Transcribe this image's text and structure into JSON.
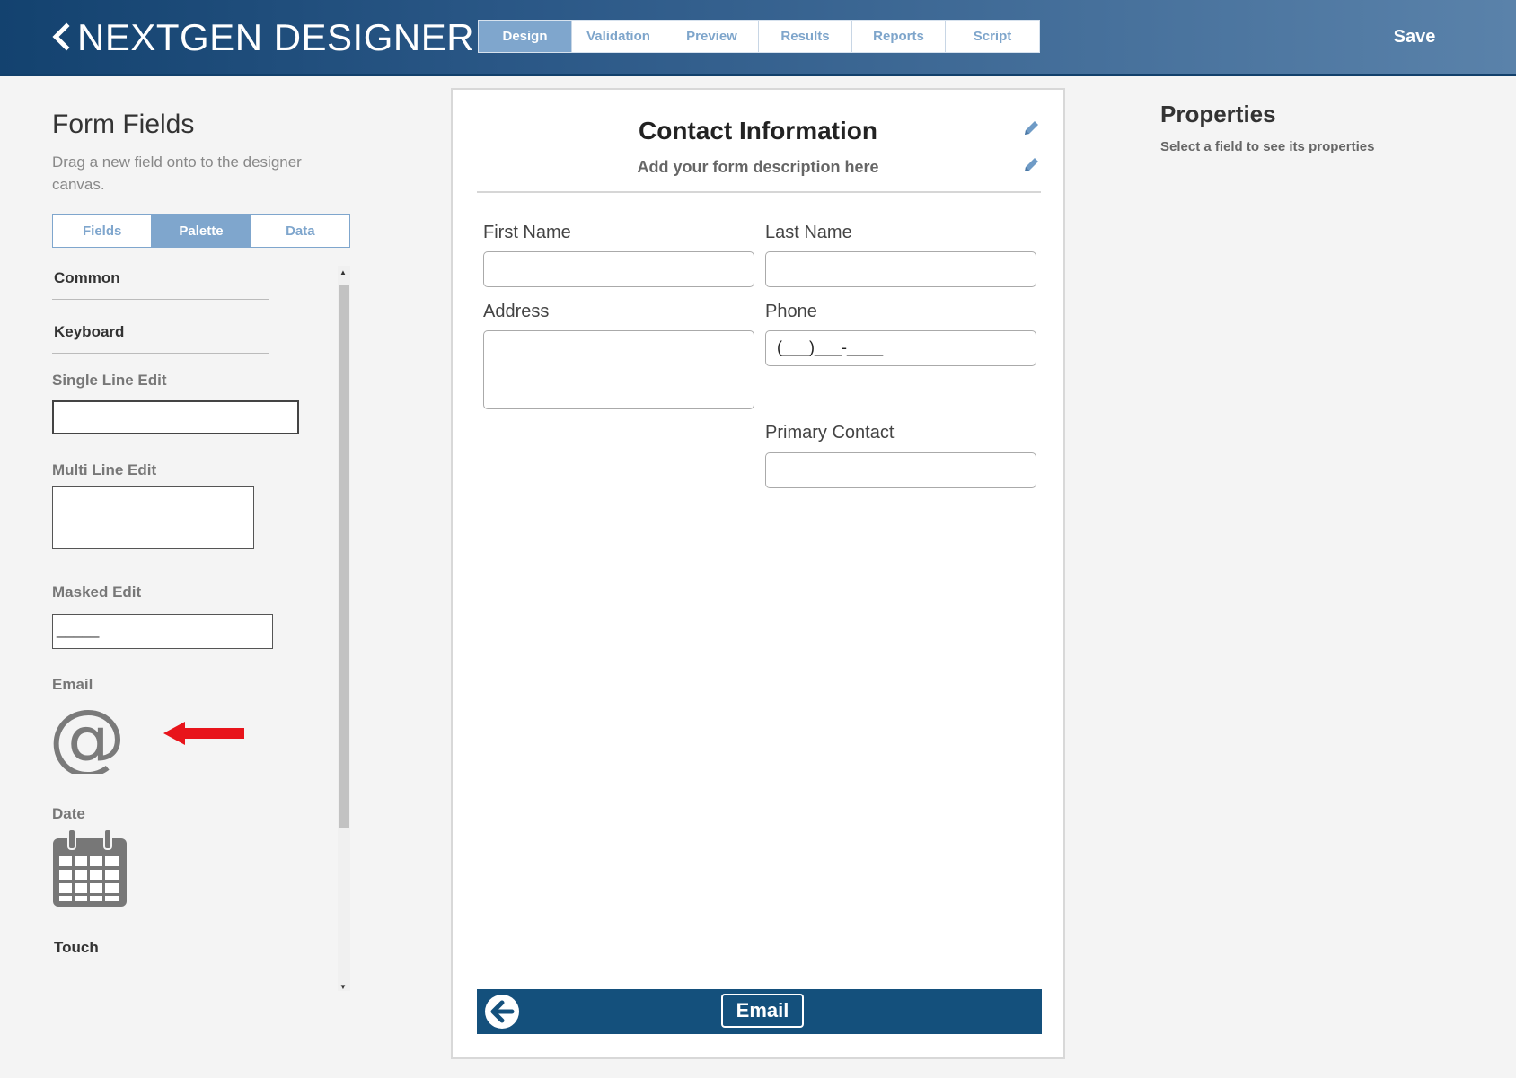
{
  "header": {
    "title": "NEXTGEN DESIGNER",
    "tabs": [
      {
        "label": "Design",
        "active": true
      },
      {
        "label": "Validation",
        "active": false
      },
      {
        "label": "Preview",
        "active": false
      },
      {
        "label": "Results",
        "active": false
      },
      {
        "label": "Reports",
        "active": false
      },
      {
        "label": "Script",
        "active": false
      }
    ],
    "save_label": "Save"
  },
  "left_panel": {
    "title": "Form Fields",
    "description": "Drag a new field onto to the designer canvas.",
    "segments": [
      {
        "label": "Fields",
        "active": false
      },
      {
        "label": "Palette",
        "active": true
      },
      {
        "label": "Data",
        "active": false
      }
    ],
    "palette": {
      "categories": [
        "Common",
        "Keyboard",
        "Touch"
      ],
      "items": [
        {
          "label": "Single Line Edit"
        },
        {
          "label": "Multi Line Edit"
        },
        {
          "label": "Masked Edit",
          "preview_text": "_____"
        },
        {
          "label": "Email",
          "icon": "at-sign-icon"
        },
        {
          "label": "Date",
          "icon": "calendar-icon"
        }
      ]
    }
  },
  "form": {
    "title": "Contact Information",
    "description": "Add your form description here",
    "fields": [
      {
        "label": "First Name",
        "value": ""
      },
      {
        "label": "Last Name",
        "value": ""
      },
      {
        "label": "Address",
        "value": ""
      },
      {
        "label": "Phone",
        "value": "(___)___-____"
      },
      {
        "label": "Primary Contact",
        "value": ""
      }
    ],
    "footer": {
      "email_label": "Email"
    }
  },
  "properties": {
    "title": "Properties",
    "description": "Select a field to see its properties"
  },
  "colors": {
    "accent": "#7fa6cd",
    "header_dark": "#13426f",
    "footer_bar": "#14507c",
    "annotation_arrow": "#e8141b"
  }
}
